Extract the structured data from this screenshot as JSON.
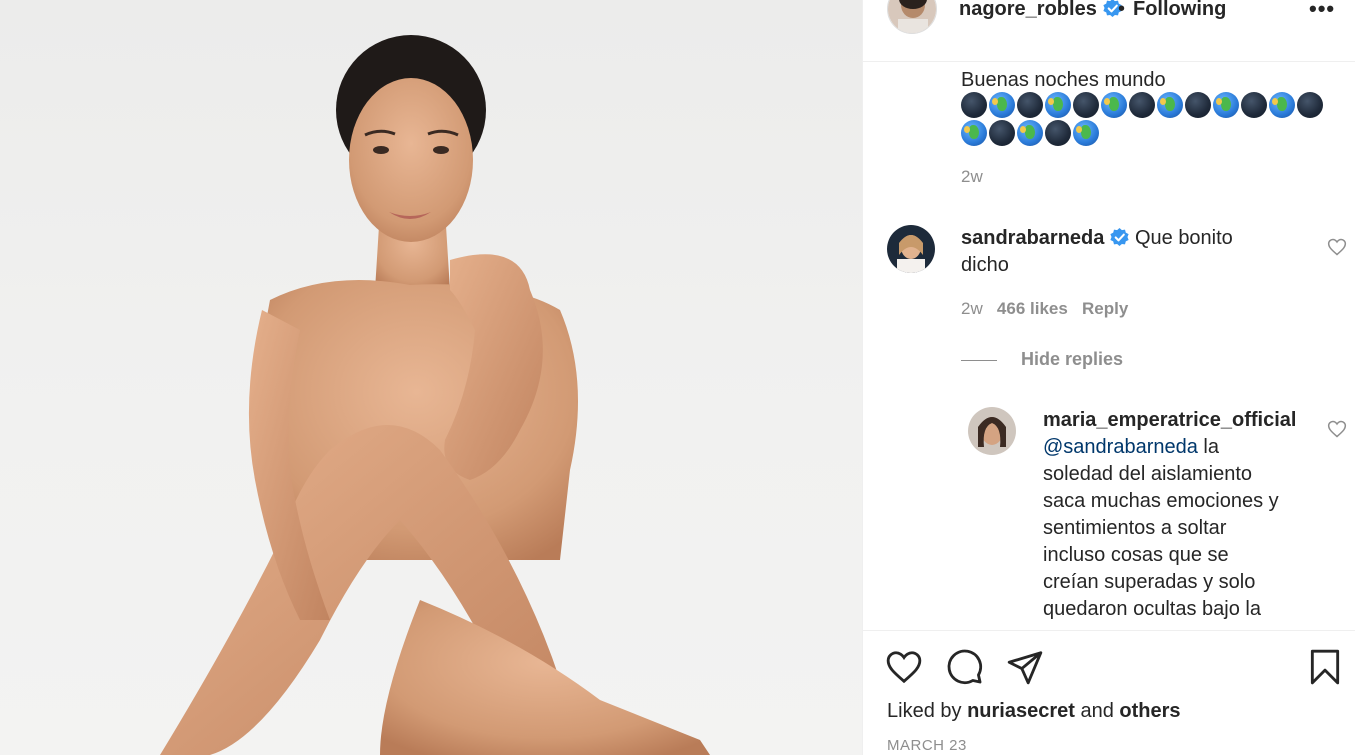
{
  "post": {
    "author": "nagore_robles",
    "separator": "•",
    "follow_status": "Following",
    "more_label": "•••"
  },
  "caption": {
    "text": "Buenas noches mundo",
    "emoji_rows": [
      [
        "dark",
        "earth",
        "dark",
        "earth",
        "dark",
        "earth",
        "dark",
        "earth",
        "dark",
        "earth",
        "dark",
        "earth",
        "dark"
      ],
      [
        "earth",
        "dark",
        "earth",
        "dark",
        "earth"
      ]
    ],
    "time": "2w"
  },
  "comments": [
    {
      "username": "sandrabarneda",
      "verified": true,
      "text_line1": "Que bonito",
      "text_line2": "dicho",
      "time": "2w",
      "likes": "466 likes",
      "reply": "Reply"
    }
  ],
  "replies_toggle": "Hide replies",
  "reply": {
    "username": "maria_emperatrice_official",
    "mention": "@sandrabarneda",
    "lines": [
      "la",
      "soledad del aislamiento",
      "saca muchas emociones y",
      "sentimientos a soltar",
      "incluso cosas que se",
      "creían superadas y solo",
      "quedaron ocultas bajo la"
    ]
  },
  "footer": {
    "liked_prefix": "Liked by",
    "liked_user": "nuriasecret",
    "liked_and": "and",
    "liked_others": "others",
    "date": "MARCH 23"
  },
  "colors": {
    "verified_blue": "#3897f0",
    "muted": "#8e8e8e",
    "mention": "#00376b",
    "text": "#262626"
  }
}
